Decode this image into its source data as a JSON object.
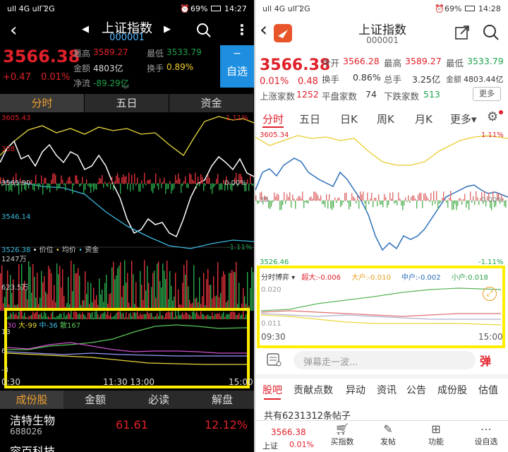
{
  "left": {
    "status": {
      "carrier": "ull 4G ull 2G",
      "battery": "69%",
      "time": "14:27"
    },
    "header": {
      "title": "上证指数",
      "code": "000001"
    },
    "quote": {
      "price": "3566.38",
      "change": "+0.47",
      "change_pct": "0.01%",
      "high_label": "最高",
      "high": "3589.27",
      "low_label": "最低",
      "low": "3533.79",
      "amount_label": "金额",
      "amount": "4803亿",
      "turnover_label": "换手",
      "turnover": "0.89%",
      "netflow_label": "净流",
      "netflow": "-89.29亿",
      "watch_button": "自选",
      "watch_minus": "−"
    },
    "tabs": [
      "分时",
      "五日",
      "资金"
    ],
    "chart": {
      "top_left": "3605.43",
      "top_right": "1.11%",
      "y2": "358",
      "y3": "3565.90",
      "mid_right": "0.00%",
      "y4": "3546.14",
      "bottom_left": "3526.38",
      "bottom_right": "-1.11%",
      "legend_price": "价位",
      "legend_avg": "均价",
      "legend_fund": "资金",
      "vol_top": "1247万",
      "vol_mid": "623.5万"
    },
    "fund": {
      "legend_1": "30",
      "legend_big_label": "大",
      "legend_big": "-99",
      "legend_mid_label": "中",
      "legend_mid": "-36",
      "legend_retail_label": "散",
      "legend_retail": "167",
      "y1": "13",
      "y2": "6",
      "y3": "-3",
      "x_start": "0:30",
      "x_mid": "11:30 13:00",
      "x_end": "15:00"
    },
    "bottom_tabs": [
      "成份股",
      "金额",
      "必读",
      "解盘"
    ],
    "stocks": [
      {
        "name": "洁特生物",
        "code": "688026",
        "price": "61.61",
        "pct": "12.12%"
      },
      {
        "name": "容百科技",
        "code": "",
        "price": "",
        "pct": ""
      }
    ]
  },
  "right": {
    "status": {
      "carrier": "ull 4G ull 2G",
      "battery": "69%",
      "time": "14:28"
    },
    "header": {
      "title": "上证指数",
      "code": "000001"
    },
    "quote": {
      "price": "3566.38",
      "change_pct": "0.01%",
      "change": "0.48",
      "open_label": "今开",
      "open": "3566.28",
      "high_label": "最高",
      "high": "3589.27",
      "low_label": "最低",
      "low": "3533.79",
      "turnover_label": "换手",
      "turnover": "0.86%",
      "totalhand_label": "总手",
      "totalhand": "3.25亿",
      "amount_label": "金额",
      "amount": "4803.44亿",
      "up_label": "上涨家数",
      "up": "1252",
      "flat_label": "平盘家数",
      "flat": "74",
      "down_label": "下跌家数",
      "down": "513",
      "more_button": "更多"
    },
    "tabs": [
      "分时",
      "五日",
      "日K",
      "周K",
      "月K",
      "更多▾"
    ],
    "chart": {
      "top_left": "3605.34",
      "top_right": "1.11%",
      "mid_left": "35",
      "mid_right": "0.00%",
      "bottom_left": "3526.46",
      "bottom_right": "-1.11%"
    },
    "fund": {
      "game_label": "分时博弈 ▾",
      "super_label": "超大:",
      "super": "-0.006",
      "big_label": "大户:",
      "big": "-0.010",
      "mid_label": "中户:",
      "mid": "-0.002",
      "small_label": "小户:",
      "small": "0.018",
      "y_top": "0.020",
      "y_bot": "0.011",
      "x_start": "09:30",
      "x_end": "15:00"
    },
    "danmu_placeholder": "弹幕走一波...",
    "danmu_button": "弹",
    "section_tabs": [
      "股吧",
      "贡献点数",
      "异动",
      "资讯",
      "公告",
      "成份股",
      "估值"
    ],
    "post_count": "共有6231312条帖子",
    "bottom_nav": {
      "price": "3566.38",
      "name": "上证",
      "pct": "0.01%",
      "items": [
        "买指数",
        "发帖",
        "功能",
        "设自选"
      ]
    }
  }
}
